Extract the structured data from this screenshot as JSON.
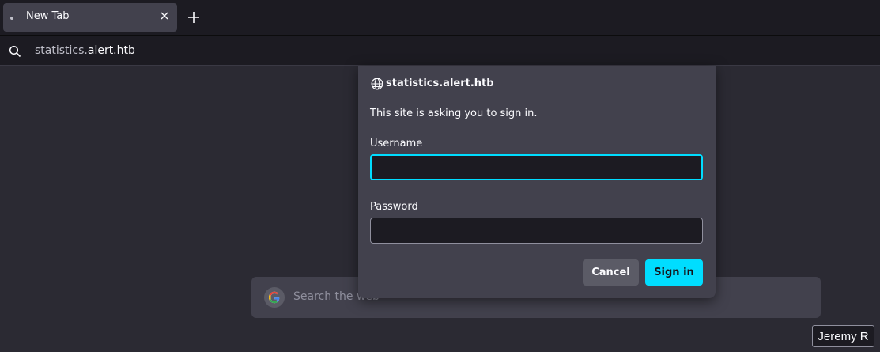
{
  "browser": {
    "tab": {
      "title": "New Tab"
    },
    "urlbar": {
      "prefix": "statistics.",
      "domain": "alert.htb"
    }
  },
  "newtab": {
    "search_placeholder": "Search the web"
  },
  "auth_dialog": {
    "host": "statistics.alert.htb",
    "message": "This site is asking you to sign in.",
    "username_label": "Username",
    "username_value": "",
    "password_label": "Password",
    "password_value": "",
    "cancel_label": "Cancel",
    "signin_label": "Sign in"
  },
  "overlay": {
    "user_label": "Jeremy R"
  },
  "colors": {
    "accent": "#00ddff",
    "toolbar": "#1c1b22",
    "background": "#2b2a33",
    "panel": "#42414d"
  },
  "icons": [
    "tab-dot-icon",
    "close-icon",
    "plus-icon",
    "search-icon",
    "globe-icon",
    "google-icon"
  ]
}
